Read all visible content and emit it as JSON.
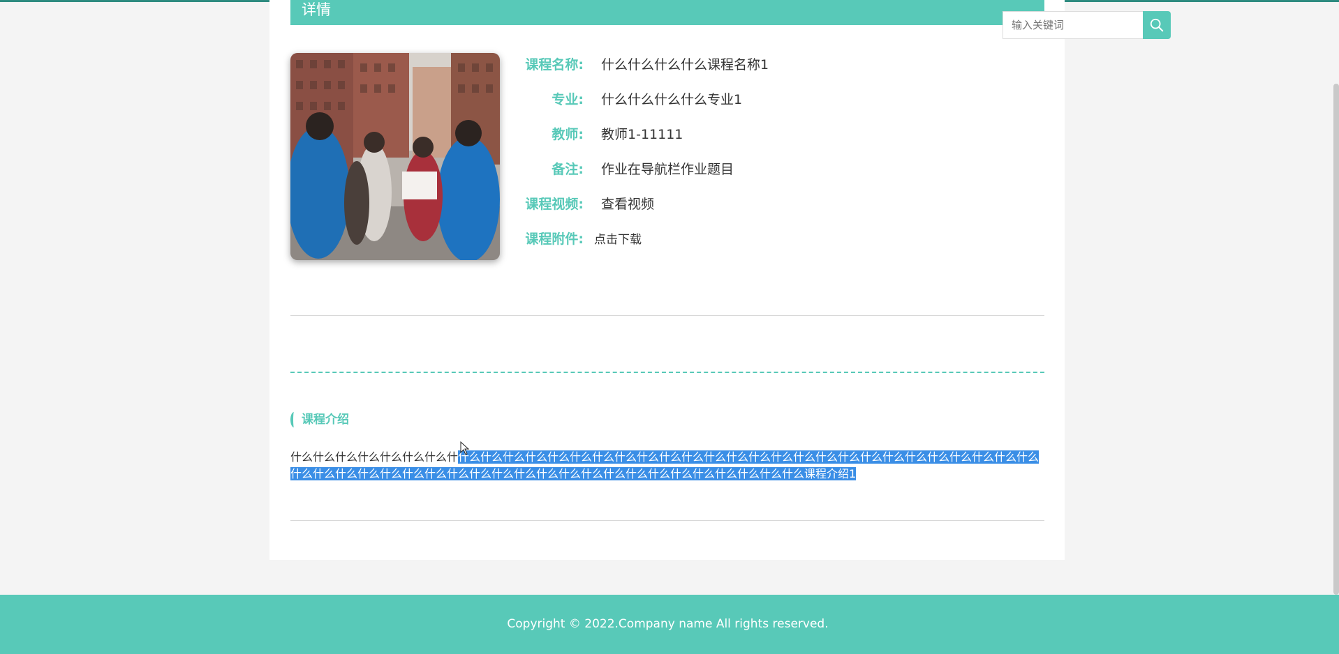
{
  "header": {
    "title": "详情"
  },
  "search": {
    "placeholder": "输入关键词"
  },
  "detail": {
    "fields": [
      {
        "label": "课程名称:",
        "value": "什么什么什么什么课程名称1"
      },
      {
        "label": "专业:",
        "value": "什么什么什么什么专业1"
      },
      {
        "label": "教师:",
        "value": "教师1-11111"
      },
      {
        "label": "备注:",
        "value": "作业在导航栏作业题目"
      },
      {
        "label": "课程视频:",
        "value": "查看视频"
      },
      {
        "label": "课程附件:",
        "value": "点击下载"
      }
    ]
  },
  "intro": {
    "heading": "课程介绍",
    "text_plain": "什么什么什么什么什么什么什么什",
    "text_selected": "什么什么什么什么什么什么什么什么什么什么什么什么什么什么什么什么什么什么什么什么什么什么什么什么什么什么什么什么什么什么什么什么什么什么什么什么什么什么什么什么什么什么什么什么什么什么什么什么什么课程介绍1"
  },
  "footer": {
    "copyright": "Copyright © 2022.Company name All rights reserved."
  },
  "colors": {
    "accent": "#58c9b8",
    "selection": "#3a8ee6"
  },
  "icons": {
    "search": "search-icon",
    "cursor": "mouse-cursor-icon"
  }
}
